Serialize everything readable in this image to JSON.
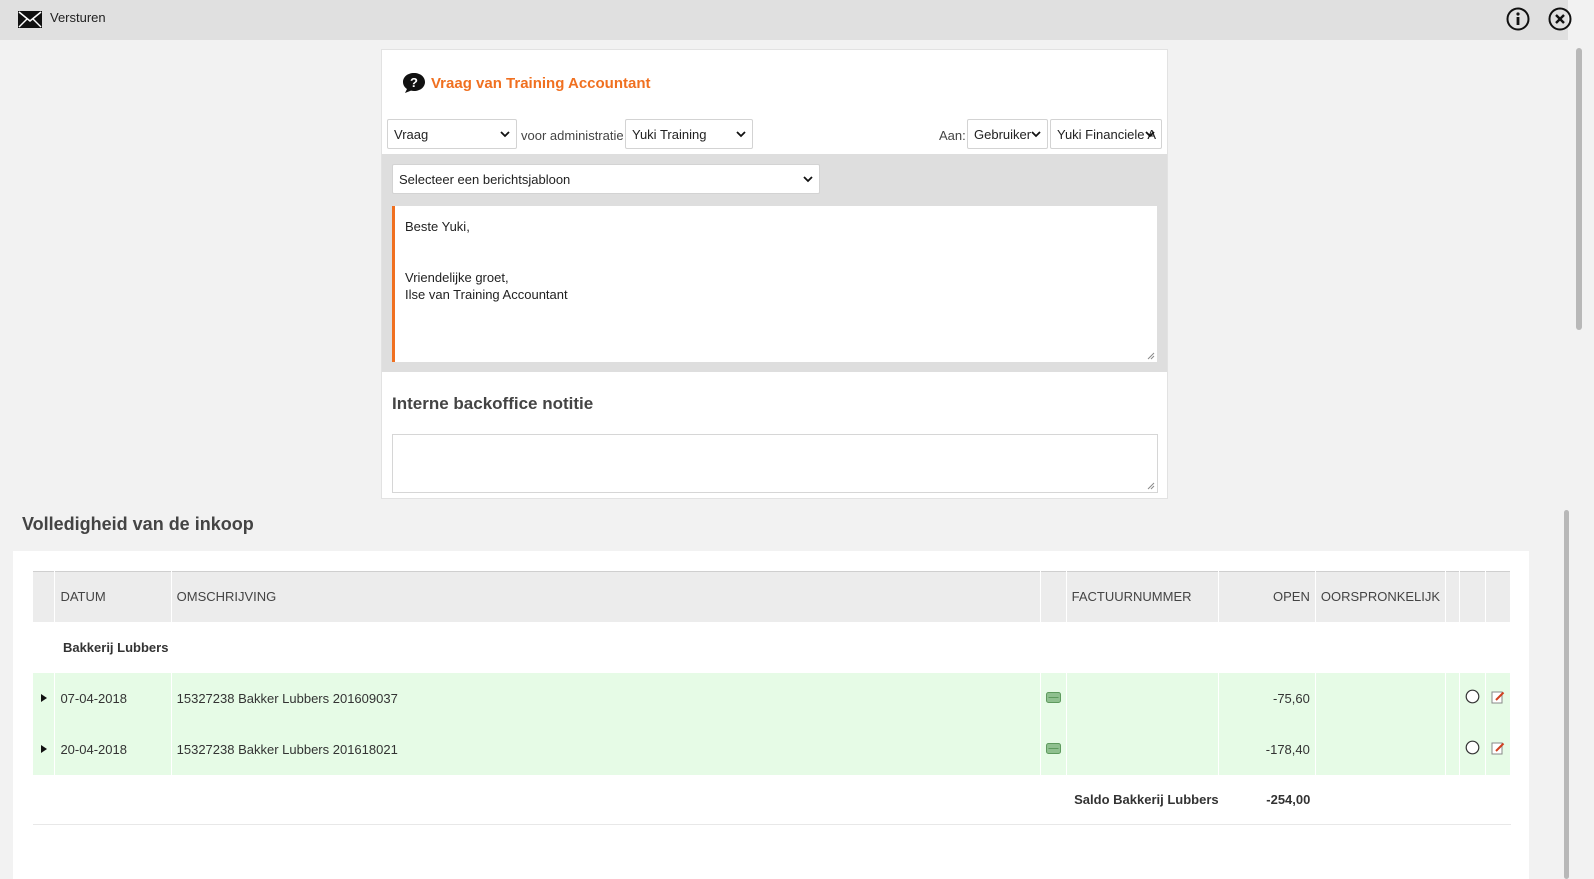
{
  "window": {
    "title": "Versturen",
    "icons": [
      "mail-icon",
      "info-icon",
      "close-icon"
    ]
  },
  "compose": {
    "title": "Vraag van Training Accountant",
    "type_select": "Vraag",
    "admin_label": "voor administratie",
    "admin_select": "Yuki Training",
    "to_label": "Aan:",
    "recipient_type_select": "Gebruiker",
    "recipient_select": "Yuki Financiele A",
    "template_select": "Selecteer een berichtsjabloon",
    "message_lines": [
      "Beste Yuki,",
      "",
      "",
      "Vriendelijke groet,",
      "Ilse van Training Accountant"
    ],
    "note_title": "Interne backoffice notitie",
    "note_value": ""
  },
  "purchase": {
    "title": "Volledigheid van de inkoop",
    "columns": {
      "date": "DATUM",
      "description": "OMSCHRIJVING",
      "invoice": "FACTUURNUMMER",
      "open": "OPEN",
      "original": "OORSPRONKELIJK"
    },
    "group": "Bakkerij Lubbers",
    "rows": [
      {
        "date": "07-04-2018",
        "description": "15327238 Bakker Lubbers 201609037",
        "invoice": "",
        "open": "-75,60",
        "original": ""
      },
      {
        "date": "20-04-2018",
        "description": "15327238 Bakker Lubbers 201618021",
        "invoice": "",
        "open": "-178,40",
        "original": ""
      }
    ],
    "saldo_label": "Saldo Bakkerij Lubbers",
    "saldo_value": "-254,00"
  },
  "colors": {
    "accent": "#f07020",
    "row_highlight": "#e6fbe6",
    "topbar": "#e0e0e0"
  }
}
